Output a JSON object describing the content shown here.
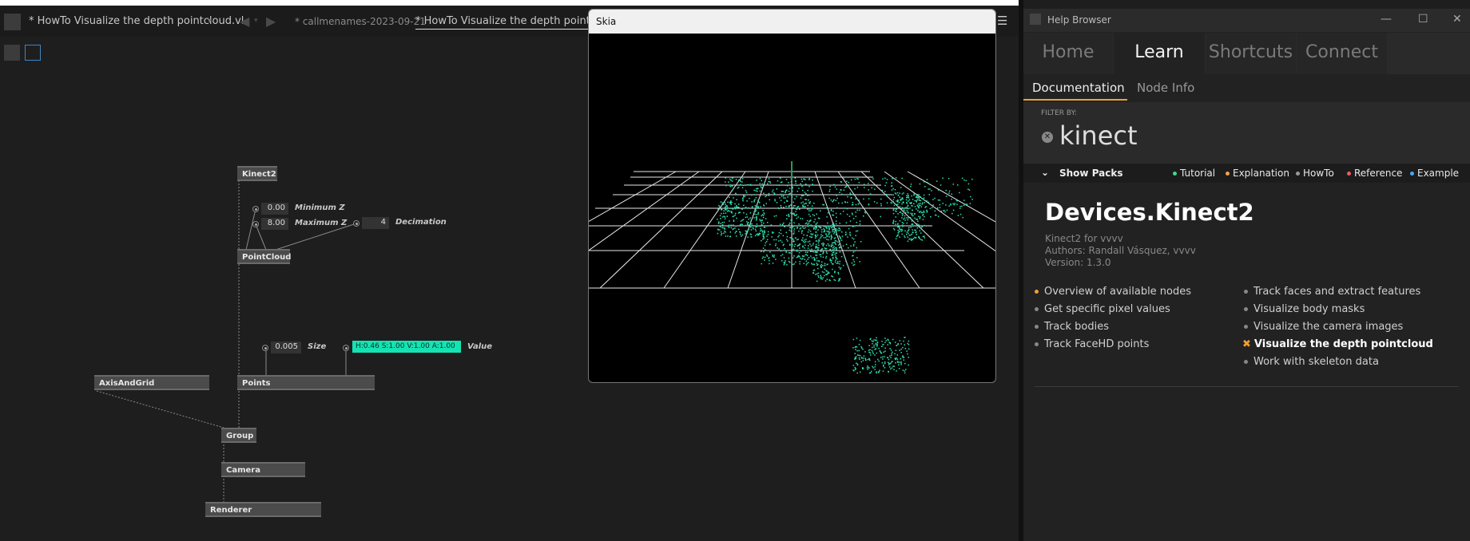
{
  "editor": {
    "tabs": [
      {
        "label": "* HowTo Visualize the depth pointcloud.vl"
      },
      {
        "label": "* callmenames-2023-09-21"
      },
      {
        "label": "* HowTo Visualize the depth pointcloud"
      }
    ],
    "nodes": {
      "kinect2": "Kinect2",
      "pointcloud": "PointCloud",
      "axisandgrid": "AxisAndGrid",
      "points": "Points",
      "group": "Group",
      "camera": "Camera",
      "renderer": "Renderer"
    },
    "pins": {
      "minz_value": "0.00",
      "minz_label": "Minimum Z",
      "maxz_value": "8.00",
      "maxz_label": "Maximum Z",
      "decimation_value": "4",
      "decimation_label": "Decimation",
      "size_value": "0.005",
      "size_label": "Size",
      "color_value": "H:0.46 S:1.00 V:1.00 A:1.00",
      "color_label": "Value"
    },
    "colors": {
      "color_pin": "#14e3b3"
    }
  },
  "skia": {
    "title": "Skia",
    "point_color": "#2fe0b0"
  },
  "help": {
    "window_title": "Help Browser",
    "top_tabs": [
      "Home",
      "Learn",
      "Shortcuts",
      "Connect"
    ],
    "active_top_tab": "Learn",
    "sub_tabs": [
      "Documentation",
      "Node Info"
    ],
    "filter_caption": "FILTER BY:",
    "filter_value": "kinect",
    "show_packs": "Show Packs",
    "tags": [
      {
        "label": "Tutorial",
        "color": "#3ddc84"
      },
      {
        "label": "Explanation",
        "color": "#f0a050"
      },
      {
        "label": "HowTo",
        "color": "#9a9a9a"
      },
      {
        "label": "Reference",
        "color": "#ef5a6a"
      },
      {
        "label": "Example",
        "color": "#4aa8f0"
      }
    ],
    "pack_title": "Devices.Kinect2",
    "pack_subtitle": "Kinect2 for vvvv",
    "pack_authors": "Authors: Randall Vásquez, vvvv",
    "pack_version": "Version: 1.3.0",
    "list_left": [
      "Overview of available nodes",
      "Get specific pixel values",
      "Track bodies",
      "Track FaceHD points"
    ],
    "list_right": [
      "Track faces and extract features",
      "Visualize body masks",
      "Visualize the camera images",
      "Visualize the depth pointcloud",
      "Work with skeleton data"
    ],
    "accent": "#f0a030"
  }
}
